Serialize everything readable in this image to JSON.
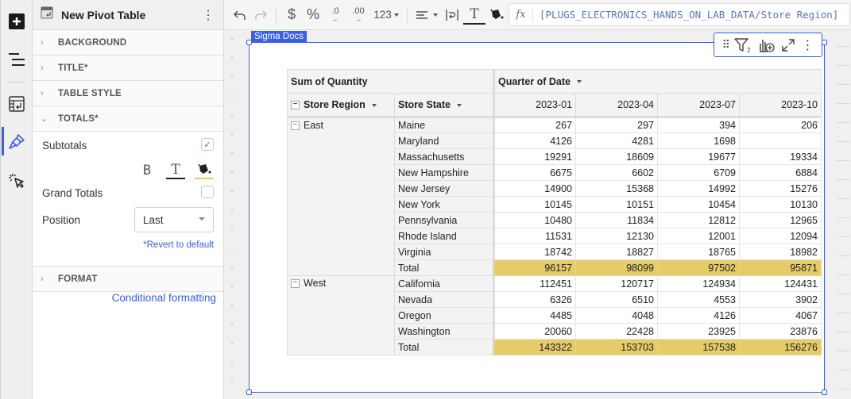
{
  "panel": {
    "title": "New Pivot Table",
    "sections": {
      "background": "BACKGROUND",
      "title": "TITLE*",
      "table_style": "TABLE STYLE",
      "totals": "TOTALS*",
      "format": "FORMAT"
    },
    "totals": {
      "subtotals_label": "Subtotals",
      "subtotals_checked": true,
      "grand_totals_label": "Grand Totals",
      "grand_totals_checked": false,
      "position_label": "Position",
      "position_value": "Last",
      "revert_label": "*Revert to default",
      "check_mark": "✓"
    },
    "conditional_formatting": "Conditional formatting"
  },
  "toolbar": {
    "number_format": "123",
    "formula": "[PLUGS_ELECTRONICS_HANDS_ON_LAB_DATA/Store Region]"
  },
  "sheet": {
    "tag": "Sigma Docs"
  },
  "pivot": {
    "value_label": "Sum of Quantity",
    "column_field": "Quarter of Date",
    "row_fields": [
      "Store Region",
      "Store State"
    ],
    "columns": [
      "2023-01",
      "2023-04",
      "2023-07",
      "2023-10"
    ],
    "total_label": "Total",
    "colors": {
      "total_fill": "#e6cb69",
      "accent": "#3a5ee8"
    },
    "groups": [
      {
        "region": "East",
        "rows": [
          {
            "state": "Maine",
            "values": [
              "267",
              "297",
              "394",
              "206"
            ]
          },
          {
            "state": "Maryland",
            "values": [
              "4126",
              "4281",
              "1698",
              ""
            ]
          },
          {
            "state": "Massachusetts",
            "values": [
              "19291",
              "18609",
              "19677",
              "19334"
            ]
          },
          {
            "state": "New Hampshire",
            "values": [
              "6675",
              "6602",
              "6709",
              "6884"
            ]
          },
          {
            "state": "New Jersey",
            "values": [
              "14900",
              "15368",
              "14992",
              "15276"
            ]
          },
          {
            "state": "New York",
            "values": [
              "10145",
              "10151",
              "10454",
              "10130"
            ]
          },
          {
            "state": "Pennsylvania",
            "values": [
              "10480",
              "11834",
              "12812",
              "12965"
            ]
          },
          {
            "state": "Rhode Island",
            "values": [
              "11531",
              "12130",
              "12001",
              "12094"
            ]
          },
          {
            "state": "Virginia",
            "values": [
              "18742",
              "18827",
              "18765",
              "18982"
            ]
          }
        ],
        "totals": [
          "96157",
          "98099",
          "97502",
          "95871"
        ]
      },
      {
        "region": "West",
        "rows": [
          {
            "state": "California",
            "values": [
              "112451",
              "120717",
              "124934",
              "124431"
            ]
          },
          {
            "state": "Nevada",
            "values": [
              "6326",
              "6510",
              "4553",
              "3902"
            ]
          },
          {
            "state": "Oregon",
            "values": [
              "4485",
              "4048",
              "4126",
              "4067"
            ]
          },
          {
            "state": "Washington",
            "values": [
              "20060",
              "22428",
              "23925",
              "23876"
            ]
          }
        ],
        "totals": [
          "143322",
          "153703",
          "157538",
          "156276"
        ]
      }
    ]
  }
}
